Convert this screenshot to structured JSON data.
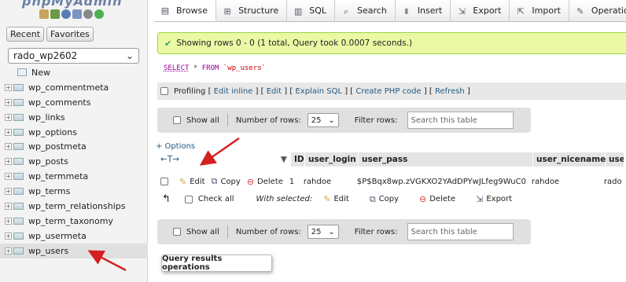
{
  "logo": {
    "text": "phpMyAdmin"
  },
  "sidebar": {
    "recent_label": "Recent",
    "favorites_label": "Favorites",
    "database": "rado_wp2602",
    "new_label": "New",
    "tables": [
      "wp_commentmeta",
      "wp_comments",
      "wp_links",
      "wp_options",
      "wp_postmeta",
      "wp_posts",
      "wp_termmeta",
      "wp_terms",
      "wp_term_relationships",
      "wp_term_taxonomy",
      "wp_usermeta",
      "wp_users"
    ]
  },
  "topnav": {
    "tabs": [
      "Browse",
      "Structure",
      "SQL",
      "Search",
      "Insert",
      "Export",
      "Import",
      "Operations"
    ]
  },
  "success": {
    "message": "Showing rows 0 - 0 (1 total, Query took 0.0007 seconds.)"
  },
  "sql": {
    "select": "SELECT",
    "star": " * ",
    "from": "FROM",
    "table": "`wp_users`"
  },
  "profiling": {
    "label": "Profiling",
    "edit_inline": "Edit inline",
    "edit": "Edit",
    "explain": "Explain SQL",
    "create_php": "Create PHP code",
    "refresh": "Refresh"
  },
  "nav_controls": {
    "show_all": "Show all",
    "rows_label": "Number of rows:",
    "rows_value": "25",
    "filter_label": "Filter rows:",
    "filter_placeholder": "Search this table"
  },
  "options_link": "+ Options",
  "columns": [
    "ID",
    "user_login",
    "user_pass",
    "user_nicename",
    "user"
  ],
  "row": {
    "edit": "Edit",
    "copy": "Copy",
    "delete": "Delete",
    "id": "1",
    "user_login": "rahdoe",
    "user_pass": "$P$Bqx8wp.zVGKXO2YAdDPYwJLfeg9WuC0",
    "user_nicename": "rahdoe",
    "user_extra": "rado"
  },
  "with_selected": {
    "check_all": "Check all",
    "label": "With selected:",
    "edit": "Edit",
    "copy": "Copy",
    "delete": "Delete",
    "export": "Export"
  },
  "tooltip": "Query results operations",
  "colors": {
    "success_bg": "#ebf8a4",
    "link": "#235a81",
    "arrow": "#d42020"
  }
}
